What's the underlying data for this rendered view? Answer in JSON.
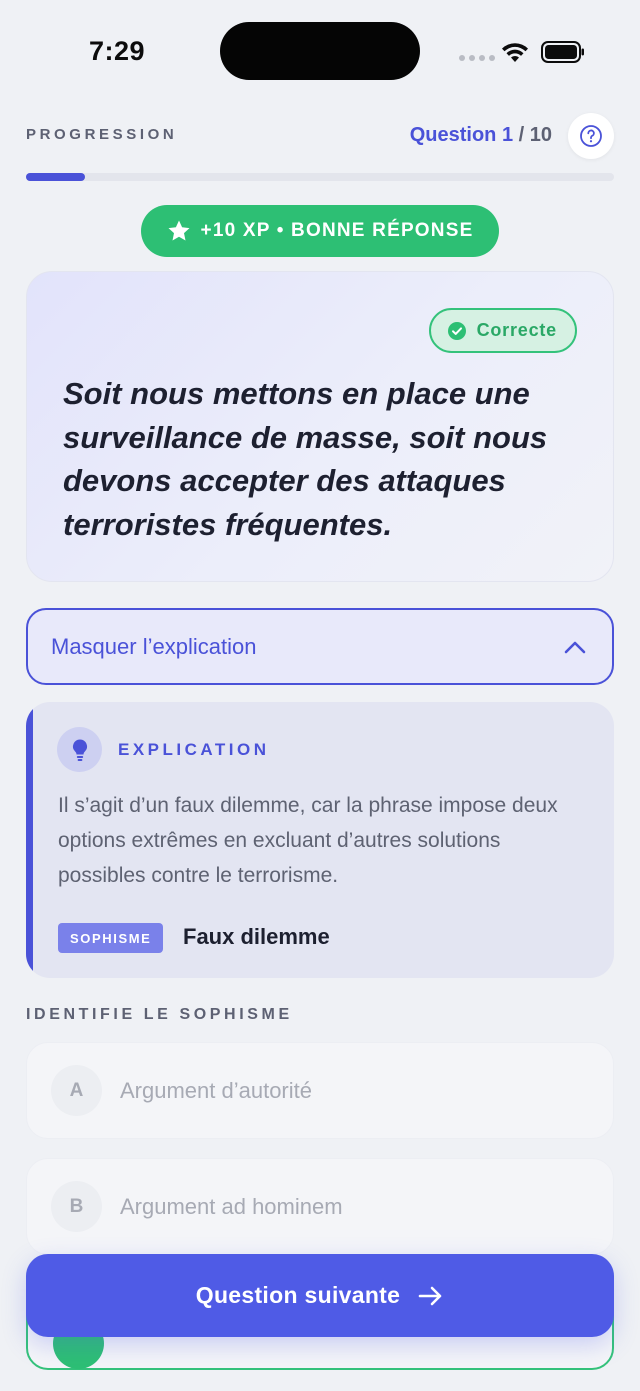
{
  "status_bar": {
    "time": "7:29"
  },
  "progress": {
    "label": "PROGRESSION",
    "question_word": "Question",
    "current": "1",
    "separator": "/",
    "total": "10",
    "fraction": 0.1
  },
  "reward": {
    "text": "+10 XP • BONNE RÉPONSE"
  },
  "statement": {
    "badge": "Correcte",
    "text": "Soit nous mettons en place une surveillance de masse, soit nous devons accepter des attaques terroristes fréquentes."
  },
  "explanation_toggle": {
    "label": "Masquer l’explication"
  },
  "explanation": {
    "title": "EXPLICATION",
    "body": "Il s’agit d’un faux dilemme, car la phrase impose deux options extrêmes en excluant d’autres solutions possibles contre le terrorisme.",
    "tag": "SOPHISME",
    "fallacy": "Faux dilemme"
  },
  "quiz": {
    "section_label": "IDENTIFIE LE SOPHISME",
    "options": [
      {
        "letter": "A",
        "label": "Argument d’autorité"
      },
      {
        "letter": "B",
        "label": "Argument ad hominem"
      }
    ]
  },
  "next_button": {
    "label": "Question suivante"
  },
  "colors": {
    "accent": "#4a52d8",
    "success": "#2dbf74",
    "background": "#eff1f5"
  },
  "icons": [
    "wifi-icon",
    "battery-icon",
    "help-icon",
    "star-icon",
    "check-circle-icon",
    "chevron-up-icon",
    "lightbulb-icon",
    "arrow-right-icon"
  ]
}
